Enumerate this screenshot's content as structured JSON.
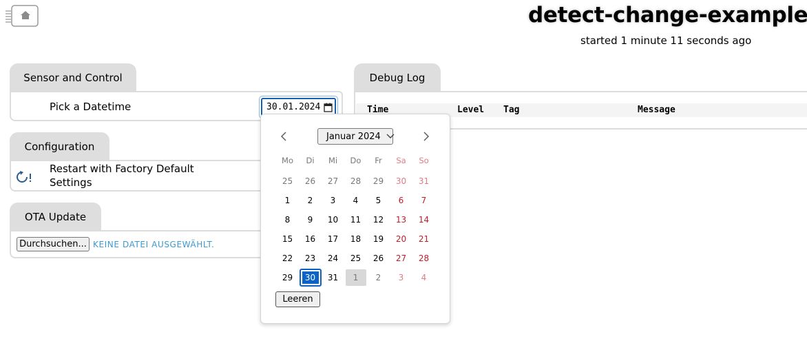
{
  "header": {
    "title": "detect-change-example",
    "subtitle": "started 1 minute 11 seconds ago",
    "logo_icon": "home-chip-icon"
  },
  "sensor_card": {
    "tab_label": "Sensor and Control",
    "datetime_label": "Pick a Datetime",
    "datetime_value": "30.01.2024",
    "calendar_icon": "calendar-icon"
  },
  "config_card": {
    "tab_label": "Configuration",
    "restart_icon": "restart-warning-icon",
    "restart_label_line1": "Restart with Factory Default",
    "restart_label_line2": "Settings"
  },
  "ota_card": {
    "tab_label": "OTA Update",
    "browse_label": "Durchsuchen...",
    "file_status": "KEINE DATEI AUSGEWÄHLT."
  },
  "debug_log": {
    "tab_label": "Debug Log",
    "columns": [
      "Time",
      "Level",
      "Tag",
      "Message"
    ]
  },
  "calendar": {
    "month_label": "Januar 2024",
    "prev_icon": "chevron-left-icon",
    "next_icon": "chevron-right-icon",
    "weekdays": [
      "Mo",
      "Di",
      "Mi",
      "Do",
      "Fr",
      "Sa",
      "So"
    ],
    "weeks": [
      [
        "25",
        "26",
        "27",
        "28",
        "29",
        "30",
        "31"
      ],
      [
        "1",
        "2",
        "3",
        "4",
        "5",
        "6",
        "7"
      ],
      [
        "8",
        "9",
        "10",
        "11",
        "12",
        "13",
        "14"
      ],
      [
        "15",
        "16",
        "17",
        "18",
        "19",
        "20",
        "21"
      ],
      [
        "22",
        "23",
        "24",
        "25",
        "26",
        "27",
        "28"
      ],
      [
        "29",
        "30",
        "31",
        "1",
        "2",
        "3",
        "4"
      ]
    ],
    "selected_day": "30",
    "today_day": "1",
    "clear_label": "Leeren"
  },
  "colors": {
    "accent": "#0b63c7",
    "weekend": "#c01c28",
    "file_status": "#3a9ad1",
    "tab_bg": "#dedede"
  }
}
